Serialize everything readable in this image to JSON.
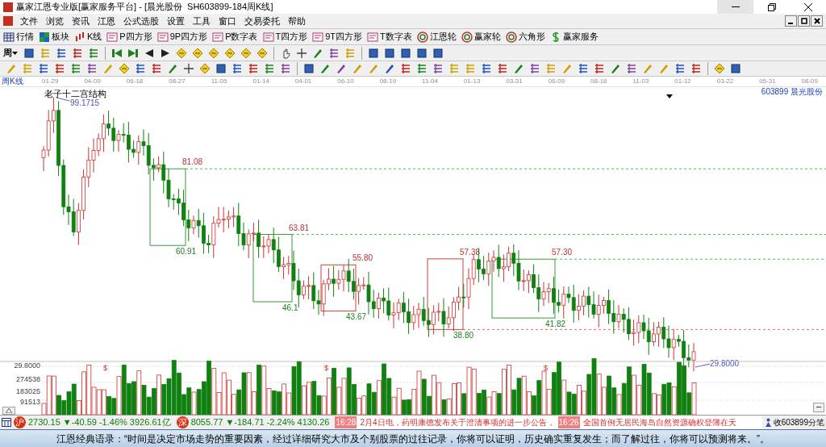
{
  "window": {
    "title": "赢家江恩专业版[赢家服务平台] - [晨光股份  SH603899-184周K线]"
  },
  "menu": [
    "文件",
    "浏览",
    "资讯",
    "江恩",
    "公式选股",
    "设置",
    "工具",
    "窗口",
    "交易委托",
    "帮助"
  ],
  "toolbar": [
    {
      "label": "行情",
      "kind": "grid"
    },
    {
      "label": "板块",
      "kind": "blocks"
    },
    {
      "label": "K线",
      "kind": "candles"
    },
    {
      "label": "P四方形",
      "kind": "tag"
    },
    {
      "label": "9P四方形",
      "kind": "tag"
    },
    {
      "label": "P数字表",
      "kind": "tag"
    },
    {
      "label": "T四方形",
      "kind": "tag"
    },
    {
      "label": "9T四方形",
      "kind": "tag"
    },
    {
      "label": "T数字表",
      "kind": "tag"
    },
    {
      "label": "江恩轮",
      "kind": "ring"
    },
    {
      "label": "赢家轮",
      "kind": "ring"
    },
    {
      "label": "六角形",
      "kind": "ring"
    },
    {
      "label": "赢家服务",
      "kind": "dollar"
    }
  ],
  "period_selector": "周",
  "date_axis": {
    "period_label": "周K线",
    "dates": [
      "01-29",
      "04-09",
      "06-18",
      "08-27",
      "11-05",
      "01-14",
      "04-01",
      "06-10",
      "08-19",
      "11-04",
      "01-13",
      "03-31",
      "06-09",
      "08-18",
      "11-03",
      "01-12",
      "03-22",
      "05-31",
      "08-09"
    ]
  },
  "chart": {
    "title": "老子十二宫结构",
    "stock": "603899 晨光股份",
    "high_label": "99.1715",
    "low_label": "29.8000",
    "boxes": [
      {
        "color": "#3a9a3a",
        "top_label": "81.08",
        "bottom_label": "60.91"
      },
      {
        "color": "#3a9a3a",
        "top_label": "63.81",
        "bottom_label": "46.1"
      },
      {
        "color": "#d04040",
        "top_label": "55.80",
        "bottom_label": "43.67"
      },
      {
        "color": "#d04040",
        "top_label": "57.38",
        "bottom_label": "38.80"
      },
      {
        "color": "#3a9a3a",
        "top_label": "57.30",
        "bottom_label": "41.82"
      }
    ]
  },
  "volume": {
    "axis_labels": [
      "29.8000",
      "274538",
      "183025",
      "91513"
    ],
    "markers": [
      "$",
      "$",
      "$"
    ]
  },
  "status_bar": {
    "indices": [
      {
        "badge": "沪",
        "text": "2730.15 ▼-40.59 -1.46% 3926.61亿"
      },
      {
        "badge": "深",
        "text": "8055.77 ▼-184.71 -2.24% 4130.26"
      }
    ],
    "news": [
      {
        "time": "16:28",
        "text": "2月4日电，药明康德发布关于澄清事项的进一步公告，"
      },
      {
        "time": "16:26",
        "text": "全国首例无居民海岛自然资源确权登簿在天"
      }
    ],
    "ticks_link": "收603899分笔"
  },
  "quote": "江恩经典语录：“时间是决定市场走势的重要因素，经过详细研究大市及个别股票的过往记录，你将可以证明，历史确实重复发生；而了解过往，你将可以预测将来。”。"
}
